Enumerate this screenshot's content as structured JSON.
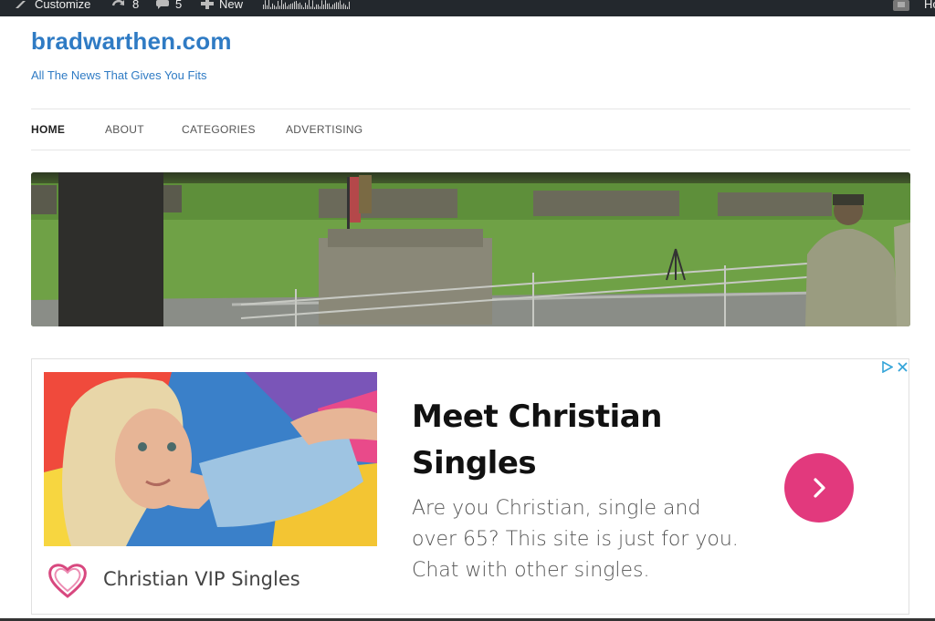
{
  "admin_bar": {
    "customize_label": "Customize",
    "updates_count": "8",
    "comments_count": "5",
    "new_label": "New",
    "howdy_label": "Ho"
  },
  "site": {
    "title": "bradwarthen.com",
    "tagline": "All The News That Gives You Fits"
  },
  "nav": {
    "items": [
      {
        "label": "HOME",
        "active": true
      },
      {
        "label": "ABOUT"
      },
      {
        "label": "CATEGORIES"
      },
      {
        "label": "ADVERTISING"
      }
    ]
  },
  "ad": {
    "headline": "Meet Christian Singles",
    "body": "Are you Christian, single and over 65? This site is just for you. Chat with other singles.",
    "brand_name": "Christian VIP Singles",
    "cta_icon": "chevron-right-icon",
    "cta_color": "#e2397d"
  },
  "colors": {
    "admin_bar_bg": "#23282d",
    "link_blue": "#2f7bc4"
  }
}
